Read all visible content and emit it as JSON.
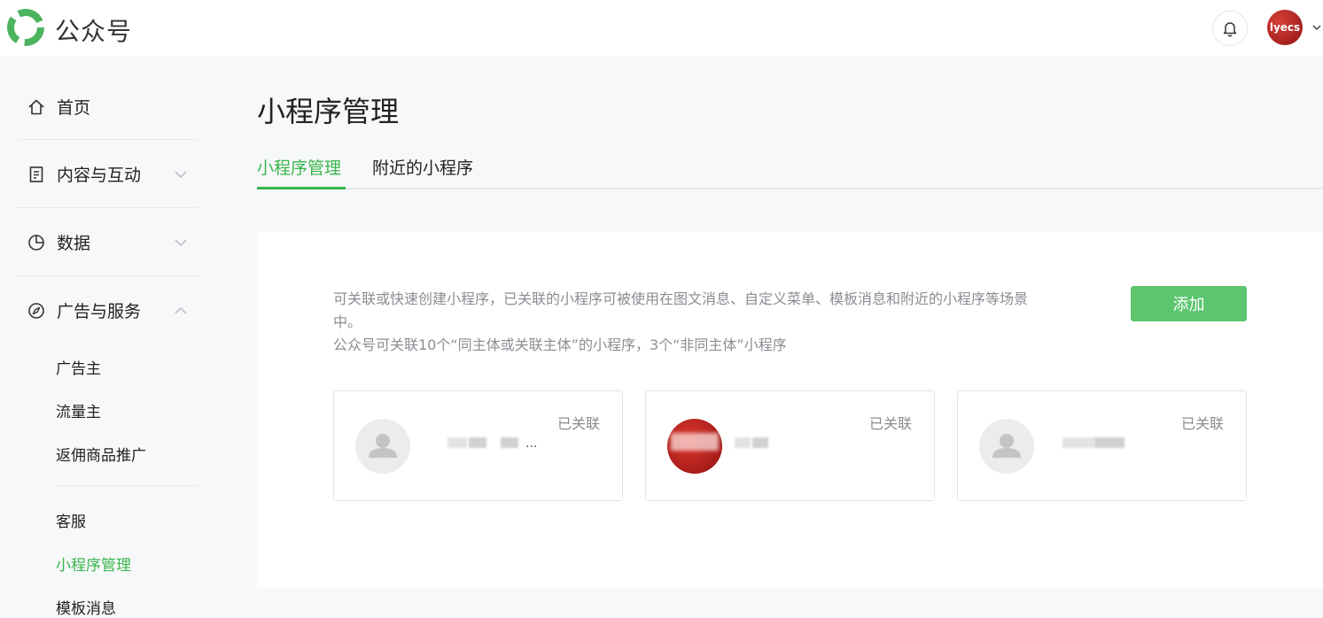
{
  "topbar": {
    "brand": "公众号",
    "avatar_text": "lyecs",
    "colors": {
      "brand_green": "#39b54a"
    }
  },
  "sidebar": {
    "items": [
      {
        "label": "首页",
        "icon": "home-icon"
      },
      {
        "label": "内容与互动",
        "icon": "document-icon",
        "expanded": false
      },
      {
        "label": "数据",
        "icon": "pie-chart-icon",
        "expanded": false
      },
      {
        "label": "广告与服务",
        "icon": "compass-icon",
        "expanded": true
      }
    ],
    "ad_sub_items": [
      "广告主",
      "流量主",
      "返佣商品推广"
    ],
    "service_sub_items": [
      "客服",
      "小程序管理",
      "模板消息"
    ],
    "active_item": "小程序管理"
  },
  "main": {
    "title": "小程序管理",
    "tabs": [
      "小程序管理",
      "附近的小程序"
    ],
    "active_tab": 0,
    "description_line1": "可关联或快速创建小程序，已关联的小程序可被使用在图文消息、自定义菜单、模板消息和附近的小程序等场景",
    "description_line1_cont": "中。",
    "description_line2": "公众号可关联10个“同主体或关联主体”的小程序，3个“非同主体”小程序",
    "add_button": "添加",
    "cards": [
      {
        "status": "已关联",
        "thumb": "default-avatar-icon",
        "name_suffix": "..."
      },
      {
        "status": "已关联",
        "thumb": "red-logo"
      },
      {
        "status": "已关联",
        "thumb": "default-avatar-icon"
      }
    ]
  }
}
